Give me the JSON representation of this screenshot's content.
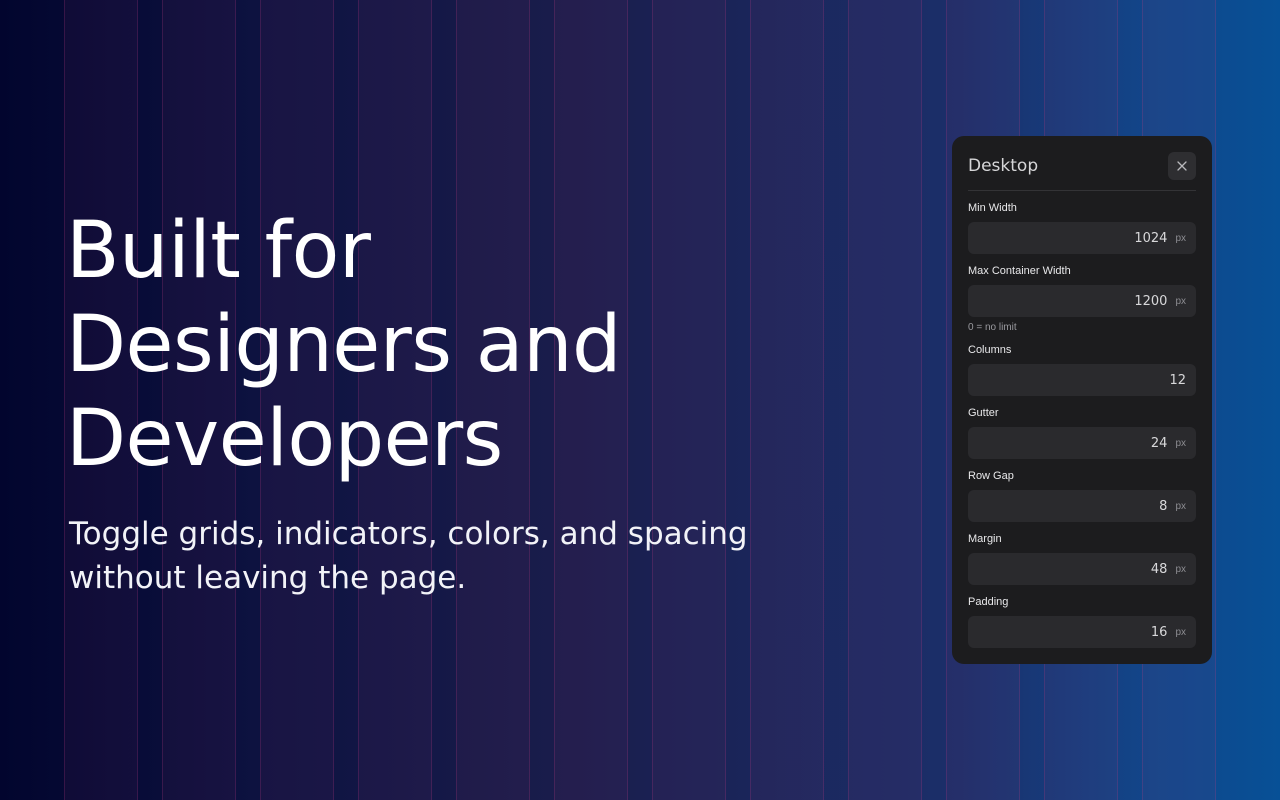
{
  "hero": {
    "title_lines": [
      "Built for",
      "Designers and",
      "Developers"
    ],
    "subtitle_lines": [
      "Toggle grids, indicators, colors, and spacing",
      "without leaving the page."
    ]
  },
  "panel": {
    "title": "Desktop",
    "close_icon": "close-icon",
    "fields": [
      {
        "label": "Min Width",
        "value": "1024",
        "unit": "px"
      },
      {
        "label": "Max Container Width",
        "value": "1200",
        "unit": "px",
        "hint": "0 = no limit"
      },
      {
        "label": "Columns",
        "value": "12"
      },
      {
        "label": "Gutter",
        "value": "24",
        "unit": "px"
      },
      {
        "label": "Row Gap",
        "value": "8",
        "unit": "px"
      },
      {
        "label": "Margin",
        "value": "48",
        "unit": "px"
      },
      {
        "label": "Padding",
        "value": "16",
        "unit": "px"
      }
    ]
  },
  "colors": {
    "background_start": "#02052e",
    "background_end": "#075096",
    "grid_column": "#b43c82",
    "panel_background": "#1c1c1e"
  }
}
